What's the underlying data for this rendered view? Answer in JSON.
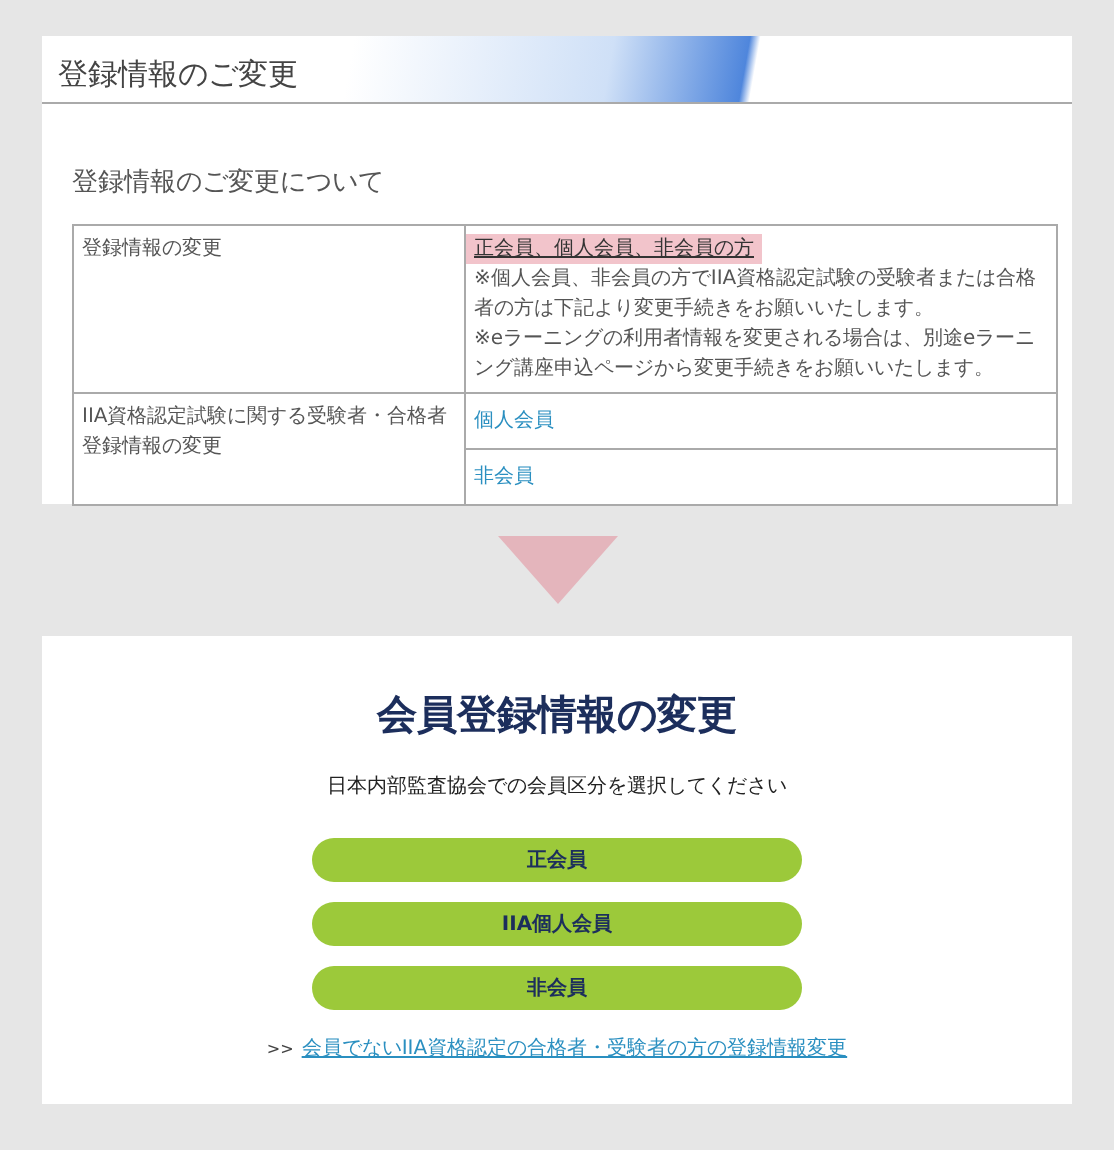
{
  "top_panel": {
    "header_title": "登録情報のご変更",
    "section_title": "登録情報のご変更について",
    "rows": [
      {
        "label": "登録情報の変更",
        "cells": [
          {
            "kind": "note",
            "link": "正会員、個人会員、非会員の方",
            "highlighted": true,
            "notes": [
              "※個人会員、非会員の方でIIA資格認定試験の受験者または合格者の方は下記より変更手続きをお願いいたします。",
              "※eラーニングの利用者情報を変更される場合は、別途eラーニング講座申込ページから変更手続きをお願いいたします。"
            ]
          }
        ]
      },
      {
        "label": "IIA資格認定試験に関する受験者・合格者登録情報の変更",
        "cells": [
          {
            "kind": "link",
            "link": "個人会員",
            "highlighted": false
          },
          {
            "kind": "link",
            "link": "非会員",
            "highlighted": false
          }
        ]
      }
    ]
  },
  "bottom_panel": {
    "title": "会員登録情報の変更",
    "instruction": "日本内部監査協会での会員区分を選択してください",
    "buttons": [
      "正会員",
      "IIA個人会員",
      "非会員"
    ],
    "footer_prefix": ">>",
    "footer_link": "会員でないIIA資格認定の合格者・受験者の方の登録情報変更"
  }
}
